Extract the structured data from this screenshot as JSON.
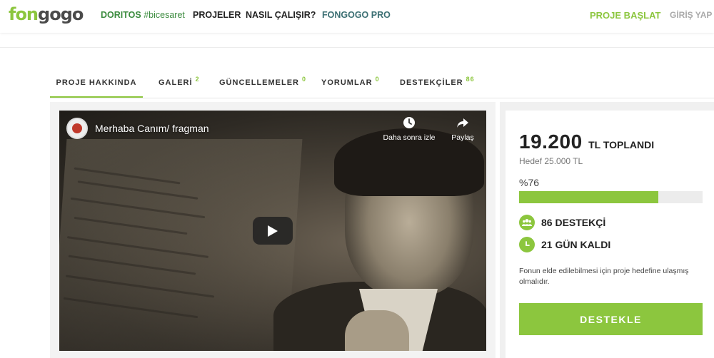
{
  "header": {
    "logo_part1": "fon",
    "logo_part2": "gogo",
    "sponsor_brand": "DORITOS",
    "sponsor_tag": "#bicesaret",
    "nav": {
      "projects": "PROJELER",
      "how_it_works": "NASIL ÇALIŞIR?",
      "pro": "FONGOGO PRO"
    },
    "start_project": "PROJE BAŞLAT",
    "login": "GİRİŞ YAP"
  },
  "tabs": [
    {
      "label": "PROJE HAKKINDA",
      "count": "",
      "active": true
    },
    {
      "label": "GALERİ",
      "count": "2"
    },
    {
      "label": "GÜNCELLEMELER",
      "count": "0"
    },
    {
      "label": "YORUMLAR",
      "count": "0"
    },
    {
      "label": "DESTEKÇİLER",
      "count": "86"
    }
  ],
  "video": {
    "title": "Merhaba Canım/ fragman",
    "watch_later": "Daha sonra izle",
    "share": "Paylaş"
  },
  "funding": {
    "raised_amount": "19.200",
    "raised_label": "TL TOPLANDI",
    "goal": "Hedef 25.000 TL",
    "percent_text": "%76",
    "percent_value": 76,
    "supporters": "86 DESTEKÇİ",
    "days_left": "21 GÜN KALDI",
    "notice": "Fonun elde edilebilmesi için proje hedefine ulaşmış olmalıdır.",
    "back_button": "DESTEKLE"
  },
  "colors": {
    "accent": "#8cc63e",
    "sponsor": "#3b8b3e",
    "pro": "#3b6f73"
  }
}
